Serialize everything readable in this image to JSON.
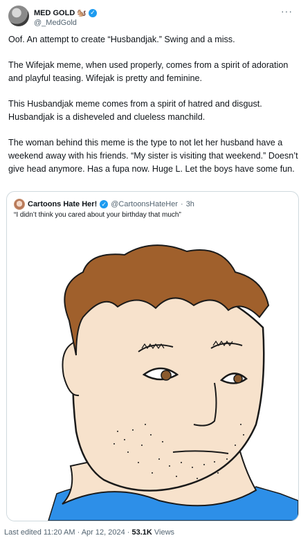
{
  "author": {
    "display_name": "MED GOLD",
    "emoji": "🐿️",
    "handle": "@_MedGold"
  },
  "more_icon": "more-horizontal-icon",
  "tweet": {
    "paragraphs": [
      "Oof. An attempt to create “Husbandjak.” Swing and a miss.",
      "The Wifejak meme, when used properly, comes from a spirit of adoration and playful teasing. Wifejak is pretty and feminine.",
      "This Husbandjak meme comes from a spirit of hatred and disgust. Husbandjak is a disheveled and clueless manchild.",
      "The woman behind this meme is the type to not let her husband have a weekend away with his friends. “My sister is visiting that weekend.” Doesn’t give head anymore. Has a fupa now. Huge L. Let the boys have some fun."
    ]
  },
  "quote": {
    "display_name": "Cartoons Hate Her!",
    "handle": "@CartoonsHateHer",
    "separator": "·",
    "time": "3h",
    "text": "“I didn’t think you cared about your birthday that much”"
  },
  "footer": {
    "edited": "Last edited 11:20 AM · Apr 12, 2024 ·",
    "views_count": "53.1K",
    "views_label": "Views"
  },
  "colors": {
    "verified": "#1d9bf0",
    "hair": "#a0602c",
    "skin": "#f7e2cc",
    "shirt": "#2d8fe8"
  }
}
